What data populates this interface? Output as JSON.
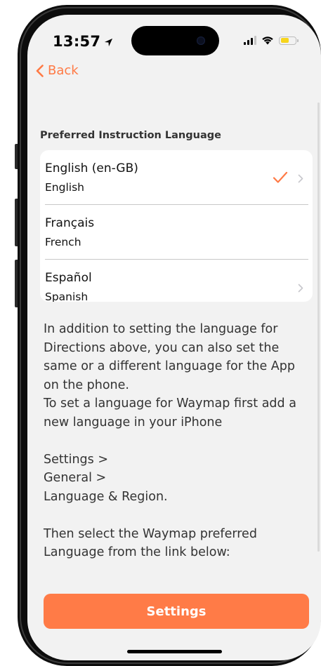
{
  "status_bar": {
    "time": "13:57"
  },
  "nav": {
    "back_label": "Back"
  },
  "section": {
    "header": "Preferred Instruction Language"
  },
  "languages": [
    {
      "primary": "English (en-GB)",
      "secondary": "English",
      "selected": true
    },
    {
      "primary": "Français",
      "secondary": "French",
      "selected": false
    },
    {
      "primary": "Español",
      "secondary": "Spanish",
      "selected": false
    }
  ],
  "info": {
    "line1": "In addition to setting the language for Directions above, you can also set the same or a different language for the App on the phone.",
    "line2": "To set a language for Waymap first add a new language in your iPhone",
    "path1": "Settings >",
    "path2": "General >",
    "path3": "Language & Region.",
    "line3": "Then select the Waymap preferred Language from the link below:"
  },
  "settings_button": {
    "label": "Settings"
  },
  "colors": {
    "accent": "#ff7a45",
    "button": "#ff7b47",
    "background": "#f2f2f2",
    "battery": "#f7d51c"
  },
  "icons": {
    "back": "chevron-left-icon",
    "check": "checkmark-icon",
    "chevron": "chevron-right-icon"
  }
}
